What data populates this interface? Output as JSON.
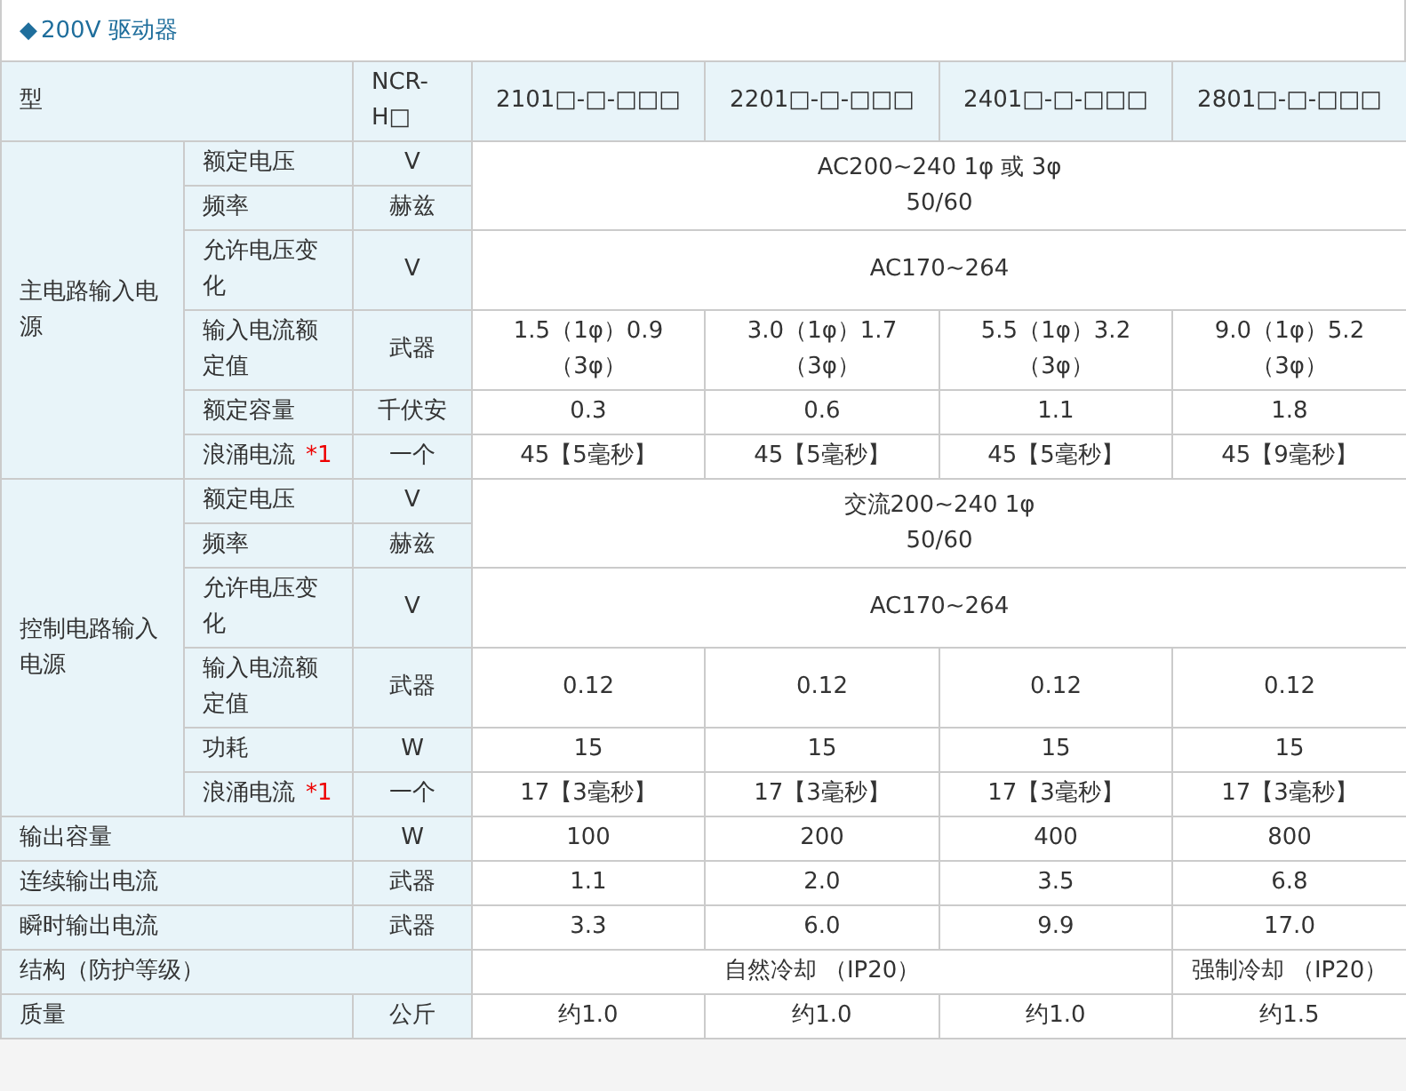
{
  "title": {
    "marker": "◆",
    "text": "200V 驱动器"
  },
  "rows": [
    {
      "cells": [
        {
          "kind": "label",
          "text": "型",
          "colspan": 2
        },
        {
          "kind": "label",
          "lines": [
            "NCR-",
            "H□"
          ]
        },
        {
          "kind": "unit",
          "text": "2101□-□-□□□"
        },
        {
          "kind": "unit",
          "text": "2201□-□-□□□"
        },
        {
          "kind": "unit",
          "text": "2401□-□-□□□"
        },
        {
          "kind": "unit",
          "text": "2801□-□-□□□"
        }
      ]
    },
    {
      "cells": [
        {
          "kind": "label",
          "text": "主电路输入电源",
          "rowspan": 6
        },
        {
          "kind": "label",
          "text": "额定电压"
        },
        {
          "kind": "unit",
          "text": "V"
        },
        {
          "kind": "value",
          "lines": [
            "AC200~240 1φ 或 3φ",
            "50/60"
          ],
          "colspan": 4,
          "rowspan": 2
        }
      ]
    },
    {
      "cells": [
        {
          "kind": "label",
          "text": "频率"
        },
        {
          "kind": "unit",
          "text": "赫兹"
        }
      ]
    },
    {
      "cells": [
        {
          "kind": "label",
          "text": "允许电压变化"
        },
        {
          "kind": "unit",
          "text": "V"
        },
        {
          "kind": "value",
          "text": "AC170~264",
          "colspan": 4
        }
      ]
    },
    {
      "cells": [
        {
          "kind": "label",
          "text": "输入电流额定值"
        },
        {
          "kind": "unit",
          "text": "武器"
        },
        {
          "kind": "value",
          "text": "1.5（1φ）0.9（3φ）"
        },
        {
          "kind": "value",
          "text": "3.0（1φ）1.7（3φ）"
        },
        {
          "kind": "value",
          "text": "5.5（1φ）3.2（3φ）"
        },
        {
          "kind": "value",
          "text": "9.0（1φ）5.2（3φ）"
        }
      ]
    },
    {
      "cells": [
        {
          "kind": "label",
          "text": "额定容量"
        },
        {
          "kind": "unit",
          "text": "千伏安"
        },
        {
          "kind": "value",
          "text": "0.3"
        },
        {
          "kind": "value",
          "text": "0.6"
        },
        {
          "kind": "value",
          "text": "1.1"
        },
        {
          "kind": "value",
          "text": "1.8"
        }
      ]
    },
    {
      "cells": [
        {
          "kind": "label",
          "text": "浪涌电流",
          "note": "*1"
        },
        {
          "kind": "unit",
          "text": "一个"
        },
        {
          "kind": "value",
          "text": "45【5毫秒】"
        },
        {
          "kind": "value",
          "text": "45【5毫秒】"
        },
        {
          "kind": "value",
          "text": "45【5毫秒】"
        },
        {
          "kind": "value",
          "text": "45【9毫秒】"
        }
      ]
    },
    {
      "cells": [
        {
          "kind": "label",
          "text": "控制电路输入电源",
          "rowspan": 6
        },
        {
          "kind": "label",
          "text": "额定电压"
        },
        {
          "kind": "unit",
          "text": "V"
        },
        {
          "kind": "value",
          "lines": [
            "交流200~240 1φ",
            "50/60"
          ],
          "colspan": 4,
          "rowspan": 2
        }
      ]
    },
    {
      "cells": [
        {
          "kind": "label",
          "text": "频率"
        },
        {
          "kind": "unit",
          "text": "赫兹"
        }
      ]
    },
    {
      "cells": [
        {
          "kind": "label",
          "text": "允许电压变化"
        },
        {
          "kind": "unit",
          "text": "V"
        },
        {
          "kind": "value",
          "text": "AC170~264",
          "colspan": 4
        }
      ]
    },
    {
      "cells": [
        {
          "kind": "label",
          "text": "输入电流额定值"
        },
        {
          "kind": "unit",
          "text": "武器"
        },
        {
          "kind": "value",
          "text": "0.12"
        },
        {
          "kind": "value",
          "text": "0.12"
        },
        {
          "kind": "value",
          "text": "0.12"
        },
        {
          "kind": "value",
          "text": "0.12"
        }
      ]
    },
    {
      "cells": [
        {
          "kind": "label",
          "text": "功耗"
        },
        {
          "kind": "unit",
          "text": "W"
        },
        {
          "kind": "value",
          "text": "15"
        },
        {
          "kind": "value",
          "text": "15"
        },
        {
          "kind": "value",
          "text": "15"
        },
        {
          "kind": "value",
          "text": "15"
        }
      ]
    },
    {
      "cells": [
        {
          "kind": "label",
          "text": "浪涌电流",
          "note": "*1"
        },
        {
          "kind": "unit",
          "text": "一个"
        },
        {
          "kind": "value",
          "text": "17【3毫秒】"
        },
        {
          "kind": "value",
          "text": "17【3毫秒】"
        },
        {
          "kind": "value",
          "text": "17【3毫秒】"
        },
        {
          "kind": "value",
          "text": "17【3毫秒】"
        }
      ]
    },
    {
      "cells": [
        {
          "kind": "label",
          "text": "输出容量",
          "colspan": 2
        },
        {
          "kind": "unit",
          "text": "W"
        },
        {
          "kind": "value",
          "text": "100"
        },
        {
          "kind": "value",
          "text": "200"
        },
        {
          "kind": "value",
          "text": "400"
        },
        {
          "kind": "value",
          "text": "800"
        }
      ]
    },
    {
      "cells": [
        {
          "kind": "label",
          "text": "连续输出电流",
          "colspan": 2
        },
        {
          "kind": "unit",
          "text": "武器"
        },
        {
          "kind": "value",
          "text": "1.1"
        },
        {
          "kind": "value",
          "text": "2.0"
        },
        {
          "kind": "value",
          "text": "3.5"
        },
        {
          "kind": "value",
          "text": "6.8"
        }
      ]
    },
    {
      "cells": [
        {
          "kind": "label",
          "text": "瞬时输出电流",
          "colspan": 2
        },
        {
          "kind": "unit",
          "text": "武器"
        },
        {
          "kind": "value",
          "text": "3.3"
        },
        {
          "kind": "value",
          "text": "6.0"
        },
        {
          "kind": "value",
          "text": "9.9"
        },
        {
          "kind": "value",
          "text": "17.0"
        }
      ]
    },
    {
      "cells": [
        {
          "kind": "label",
          "text": "结构（防护等级）",
          "colspan": 3
        },
        {
          "kind": "value",
          "text": "自然冷却 （IP20）",
          "colspan": 3
        },
        {
          "kind": "value",
          "text": "强制冷却 （IP20）"
        }
      ]
    },
    {
      "cells": [
        {
          "kind": "label",
          "text": "质量",
          "colspan": 2
        },
        {
          "kind": "unit",
          "text": "公斤"
        },
        {
          "kind": "value",
          "text": "约1.0"
        },
        {
          "kind": "value",
          "text": "约1.0"
        },
        {
          "kind": "value",
          "text": "约1.0"
        },
        {
          "kind": "value",
          "text": "约1.5"
        }
      ]
    }
  ]
}
